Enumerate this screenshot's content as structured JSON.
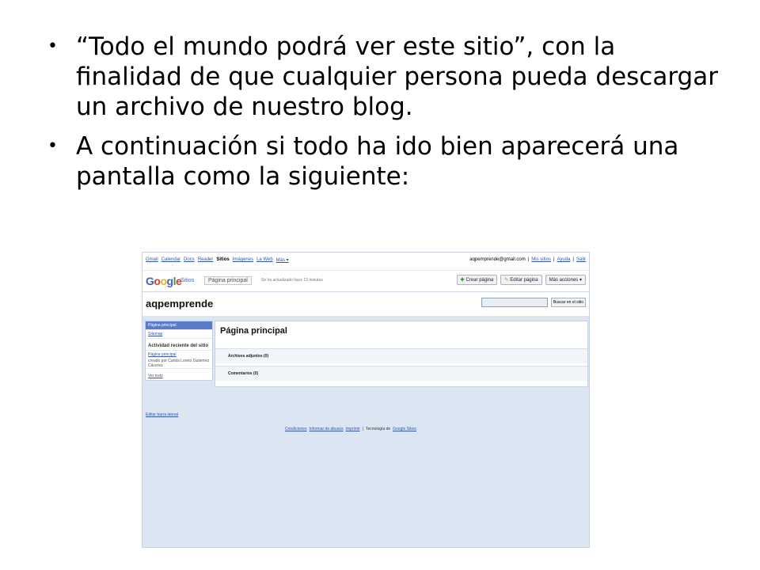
{
  "slide": {
    "bullets": [
      "“Todo el mundo podrá ver este sitio”, con la finalidad de que cualquier persona pueda descargar un archivo de nuestro blog.",
      "A continuación si todo ha ido bien aparecerá una pantalla como la siguiente:"
    ]
  },
  "screenshot": {
    "top_nav": [
      "Gmail",
      "Calendar",
      "Docs",
      "Reader",
      "Sitios",
      "Imágenes",
      "La Web",
      "Más ▾"
    ],
    "user_links": [
      "aqpemprende@gmail.com",
      "Mis sitios",
      "Ayuda",
      "Salir"
    ],
    "logo": "Google",
    "logo_suffix": "Sitios",
    "page_selector": "Página principal",
    "updated_note": "Se ha actualizado hace 13 minutos",
    "buttons": {
      "create_page": "Crear página",
      "edit_page": "Editar página",
      "more_actions": "Más acciones ▾"
    },
    "site_name": "aqpemprende",
    "search_button": "Buscar en el sitio",
    "sidebar": {
      "items": [
        "Página principal",
        "Sitemap"
      ],
      "recent_heading": "Actividad reciente del sitio",
      "recent_link": "Página principal",
      "recent_note": "creado por Carlos Loreto Gutierrez Cáceres",
      "more_link": "Ver todo",
      "edit_sidebar": "Editar barra lateral"
    },
    "main": {
      "title": "Página principal",
      "attachments": "Archivos adjuntos (0)",
      "comments": "Comentarios (0)"
    },
    "footer": {
      "links": [
        "Condiciones",
        "Informar de abusos",
        "Imprimir"
      ],
      "powered_by": "Tecnología de",
      "powered_link": "Google Sitios"
    }
  }
}
